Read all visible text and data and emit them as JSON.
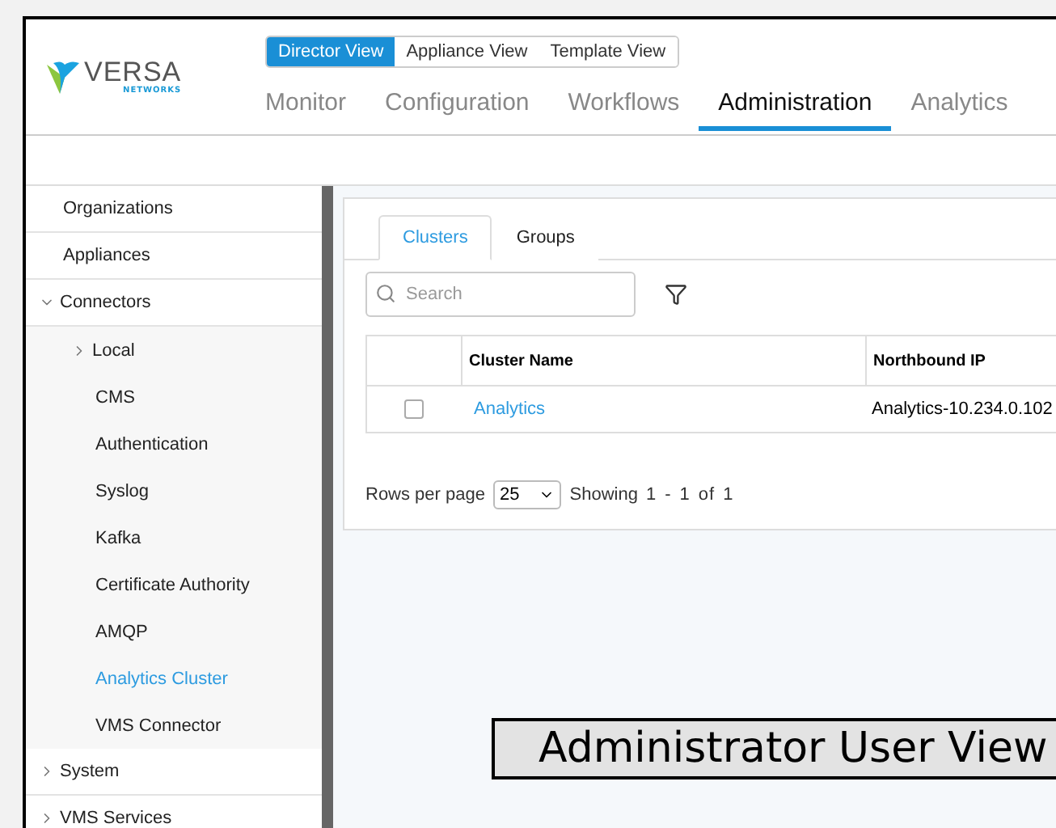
{
  "logo": {
    "name": "VERSA",
    "sub": "NETWORKS"
  },
  "view_switch": [
    {
      "label": "Director View",
      "selected": true
    },
    {
      "label": "Appliance View",
      "selected": false
    },
    {
      "label": "Template View",
      "selected": false
    }
  ],
  "nav": [
    {
      "label": "Monitor",
      "selected": false
    },
    {
      "label": "Configuration",
      "selected": false
    },
    {
      "label": "Workflows",
      "selected": false
    },
    {
      "label": "Administration",
      "selected": true
    },
    {
      "label": "Analytics",
      "selected": false
    }
  ],
  "sidebar": {
    "items": [
      {
        "label": "Organizations",
        "selected": false
      },
      {
        "label": "Appliances",
        "selected": false
      },
      {
        "label": "Connectors",
        "selected": false,
        "expanded": true,
        "children": [
          {
            "label": "Local",
            "selected": false,
            "expanded": false
          },
          {
            "label": "CMS",
            "selected": false
          },
          {
            "label": "Authentication",
            "selected": false
          },
          {
            "label": "Syslog",
            "selected": false
          },
          {
            "label": "Kafka",
            "selected": false
          },
          {
            "label": "Certificate Authority",
            "selected": false
          },
          {
            "label": "AMQP",
            "selected": false
          },
          {
            "label": "Analytics Cluster",
            "selected": true
          },
          {
            "label": "VMS Connector",
            "selected": false
          }
        ]
      },
      {
        "label": "System",
        "selected": false,
        "expanded": false
      },
      {
        "label": "VMS Services",
        "selected": false,
        "expanded": false
      }
    ]
  },
  "tabs": [
    {
      "label": "Clusters",
      "selected": true
    },
    {
      "label": "Groups",
      "selected": false
    }
  ],
  "search": {
    "placeholder": "Search"
  },
  "table": {
    "columns": [
      "Cluster Name",
      "Northbound IP"
    ],
    "rows": [
      {
        "checked": false,
        "cells": [
          "Analytics",
          "Analytics-10.234.0.102"
        ]
      }
    ]
  },
  "pagination": {
    "label": "Rows per page",
    "page_size": "25",
    "showing": "Showing",
    "range": [
      "1",
      "-",
      "1",
      "of",
      "1"
    ]
  },
  "caption": "Administrator User View"
}
